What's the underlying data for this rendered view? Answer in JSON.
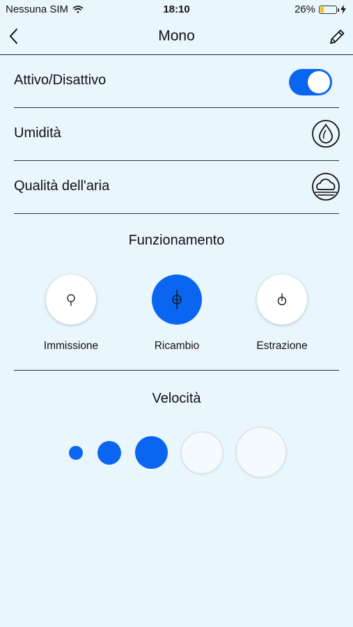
{
  "status_bar": {
    "carrier": "Nessuna SIM",
    "time": "18:10",
    "battery": "26%",
    "battery_level": 0.26
  },
  "nav": {
    "title": "Mono"
  },
  "rows": [
    {
      "label": "Attivo/Disattivo",
      "toggle_on": true
    },
    {
      "label": "Umidità",
      "icon": "humidity-drop-icon"
    },
    {
      "label": "Qualità dell'aria",
      "icon": "air-quality-cloud-icon"
    }
  ],
  "operation": {
    "title": "Funzionamento",
    "modes": [
      {
        "label": "Immissione",
        "active": false,
        "icon": "intake-icon"
      },
      {
        "label": "Ricambio",
        "active": true,
        "icon": "exchange-icon"
      },
      {
        "label": "Estrazione",
        "active": false,
        "icon": "extraction-icon"
      }
    ]
  },
  "speed": {
    "title": "Velocità",
    "levels": 5,
    "selected": 3
  },
  "colors": {
    "accent": "#0a66f0",
    "background": "#e9f6fd",
    "battery": "#f5c400"
  }
}
